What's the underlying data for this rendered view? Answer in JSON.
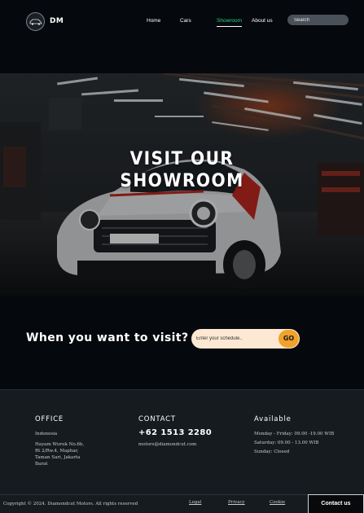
{
  "nav": {
    "brand": "DM",
    "links": [
      "Home",
      "Cars",
      "Showroom",
      "About us"
    ],
    "active_link": "Showroom",
    "search_placeholder": "Search"
  },
  "hero": {
    "title_line1": "VISIT OUR",
    "title_line2": "SHOWROOM"
  },
  "visit": {
    "heading": "When you want to visit?",
    "schedule_placeholder": "Enter your schedule..",
    "go_label": "GO"
  },
  "footer": {
    "office": {
      "title": "OFFICE",
      "country": "Indonesia",
      "address_lines": [
        "Hayam Wuruk No.6b,",
        "Rt 2/Rw.4, Maphar,",
        "Taman Sari, Jakarta",
        "Barat"
      ]
    },
    "contact": {
      "title": "CONTACT",
      "phone": "+62 1513 2280",
      "email": "motors@diamondcut.com"
    },
    "available": {
      "title": "Available",
      "hours": [
        "Monday - Friday: 09.00 -19.00 WIB",
        "Saturday: 09.00 - 13.00 WIB",
        "Sunday: Closed"
      ]
    },
    "copyright": "Copyright © 2024. Diamondcut Motors. All rights reserved",
    "legal_links": [
      "Legal",
      "Privacy",
      "Cookie"
    ],
    "contact_button": "Contact us"
  },
  "colors": {
    "background": "#05080c",
    "accent_green": "#2bd17e",
    "go_orange": "#f0a22b",
    "schedule_field": "#fce8d3",
    "footer_bg": "#161b20"
  }
}
